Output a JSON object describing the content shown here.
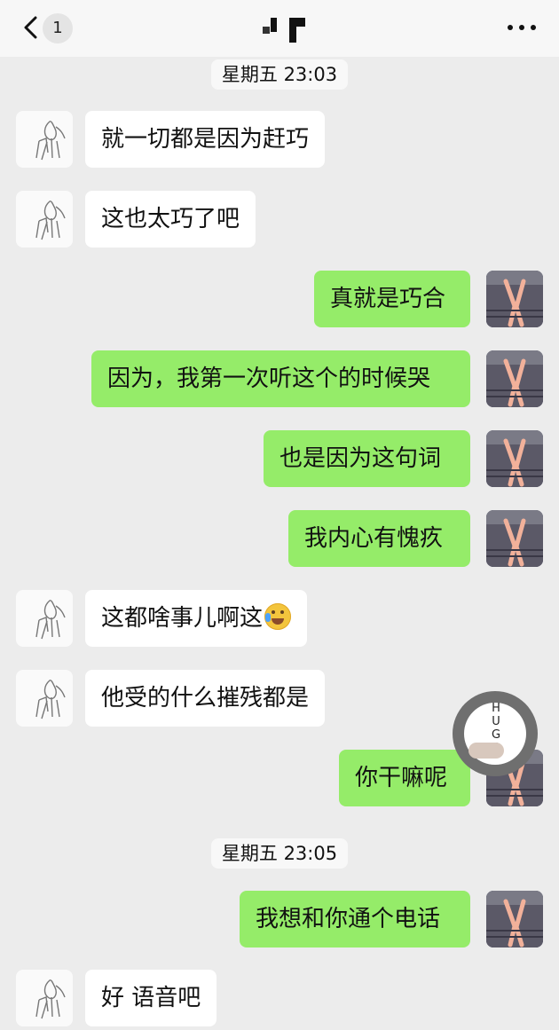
{
  "header": {
    "unread_count": "1",
    "back_icon": "chevron-left-icon",
    "more_icon": "more-horizontal-icon"
  },
  "timestamps": [
    "星期五 23:03",
    "星期五 23:05"
  ],
  "messages": [
    {
      "side": "left",
      "text": "就一切都是因为赶巧"
    },
    {
      "side": "left",
      "text": "这也太巧了吧"
    },
    {
      "side": "right",
      "text": "真就是巧合"
    },
    {
      "side": "right",
      "text": "因为，我第一次听这个的时候哭"
    },
    {
      "side": "right",
      "text": "也是因为这句词"
    },
    {
      "side": "right",
      "text": "我内心有愧疚"
    },
    {
      "side": "left",
      "text": "这都啥事儿啊这",
      "emoji": "laughing-crying-emoji"
    },
    {
      "side": "left",
      "text": "他受的什么摧残都是"
    },
    {
      "side": "right",
      "text": "你干嘛呢"
    },
    {
      "side": "right",
      "text": "我想和你通个电话"
    },
    {
      "side": "left",
      "text": "好 语音吧"
    }
  ],
  "sticker": {
    "text": "HUGO"
  },
  "colors": {
    "chat_background": "#ececec",
    "sent_bubble": "#95ec69",
    "received_bubble": "#ffffff"
  }
}
